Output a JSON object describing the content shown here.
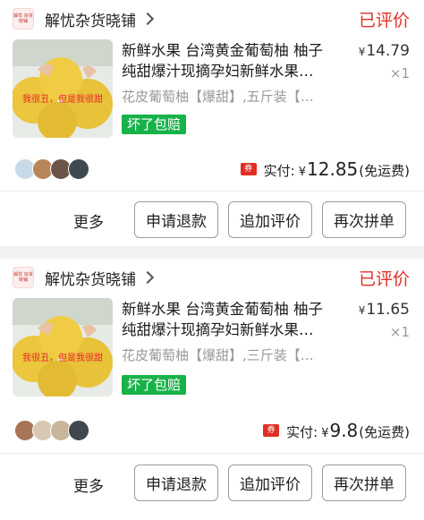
{
  "orders": [
    {
      "shop": {
        "name": "解忧杂货晓铺",
        "logo_text": "解忧 杂货晓铺"
      },
      "status": "已评价",
      "item": {
        "title_line1": "新鲜水果 台湾黄金葡萄柚 柚子",
        "title_line2": "纯甜爆汁现摘孕妇新鲜水果…",
        "image_text": "我很丑，但是我很甜",
        "spec": "花皮葡萄柚【爆甜】,五斤装【…",
        "badge": "坏了包赔",
        "price_symbol": "¥",
        "price": "14.79",
        "quantity": "×1"
      },
      "payment": {
        "coupon_icon": "券",
        "label": "实付:",
        "symbol": "¥",
        "amount": "12.85",
        "note": "(免运费)"
      },
      "actions": {
        "more": "更多",
        "refund": "申请退款",
        "add_review": "追加评价",
        "regroup": "再次拼单"
      }
    },
    {
      "shop": {
        "name": "解忧杂货晓铺",
        "logo_text": "解忧 杂货晓铺"
      },
      "status": "已评价",
      "item": {
        "title_line1": "新鲜水果 台湾黄金葡萄柚 柚子",
        "title_line2": "纯甜爆汁现摘孕妇新鲜水果…",
        "image_text": "我很丑，但是我很甜",
        "spec": "花皮葡萄柚【爆甜】,三斤装【…",
        "badge": "坏了包赔",
        "price_symbol": "¥",
        "price": "11.65",
        "quantity": "×1"
      },
      "payment": {
        "coupon_icon": "券",
        "label": "实付:",
        "symbol": "¥",
        "amount": "9.8",
        "note": "(免运费)"
      },
      "actions": {
        "more": "更多",
        "refund": "申请退款",
        "add_review": "追加评价",
        "regroup": "再次拼单"
      }
    }
  ],
  "colors": {
    "accent_red": "#e02e24",
    "badge_green": "#18b24a"
  }
}
